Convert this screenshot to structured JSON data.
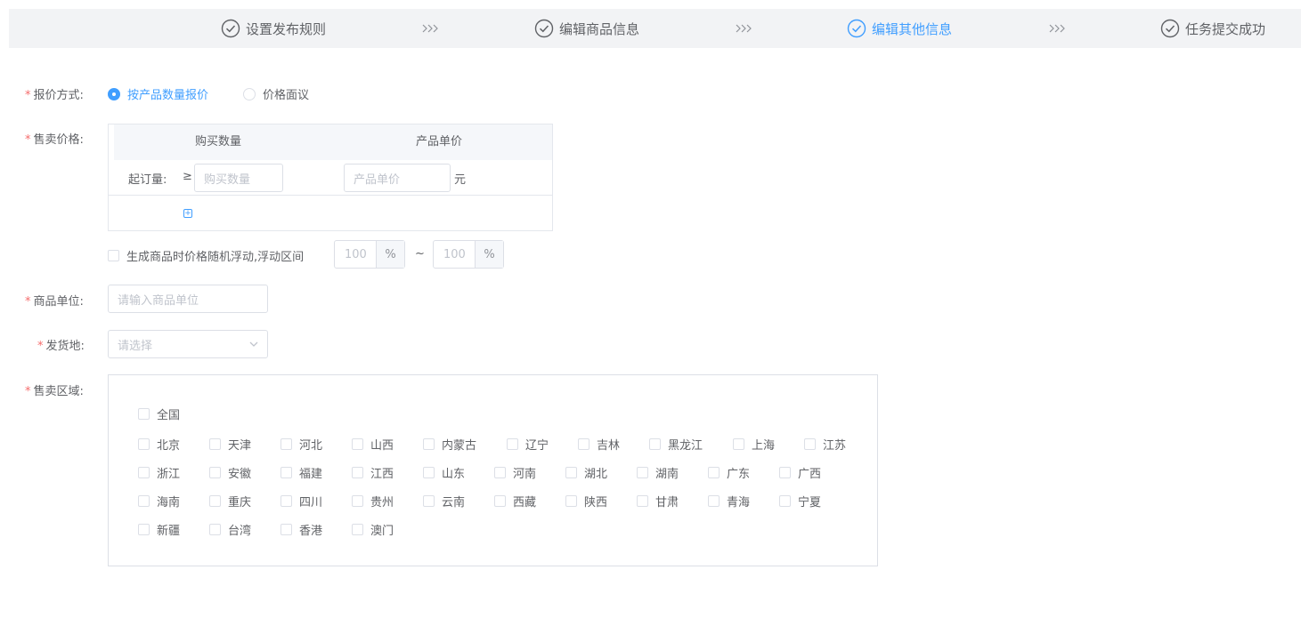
{
  "steps": [
    {
      "label": "设置发布规则",
      "active": false
    },
    {
      "label": "编辑商品信息",
      "active": false
    },
    {
      "label": "编辑其他信息",
      "active": true
    },
    {
      "label": "任务提交成功",
      "active": false
    }
  ],
  "colors": {
    "accent": "#409eff",
    "required": "#f56c6c",
    "border": "#dcdfe6"
  },
  "form": {
    "required_mark": "*",
    "quote_method": {
      "label": "报价方式:",
      "options": [
        "按产品数量报价",
        "价格面议"
      ],
      "selected": "按产品数量报价"
    },
    "sale_price": {
      "label": "售卖价格:",
      "col_qty": "购买数量",
      "col_price": "产品单价",
      "min_order_label": "起订量:",
      "gte": "≥",
      "qty_placeholder": "购买数量",
      "price_placeholder": "产品单价",
      "unit": "元",
      "add_icon": "plus-square-icon"
    },
    "random_float": {
      "label": "生成商品时价格随机浮动,浮动区间",
      "min": "100",
      "max": "100",
      "percent": "%",
      "tilde": "~"
    },
    "product_unit": {
      "label": "商品单位:",
      "placeholder": "请输入商品单位"
    },
    "ship_from": {
      "label": "发货地:",
      "placeholder": "请选择"
    },
    "sale_region": {
      "label": "售卖区域:",
      "all_label": "全国",
      "rows": [
        [
          "北京",
          "天津",
          "河北",
          "山西",
          "内蒙古",
          "辽宁",
          "吉林",
          "黑龙江",
          "上海",
          "江苏"
        ],
        [
          "浙江",
          "安徽",
          "福建",
          "江西",
          "山东",
          "河南",
          "湖北",
          "湖南",
          "广东",
          "广西"
        ],
        [
          "海南",
          "重庆",
          "四川",
          "贵州",
          "云南",
          "西藏",
          "陕西",
          "甘肃",
          "青海",
          "宁夏"
        ],
        [
          "新疆",
          "台湾",
          "香港",
          "澳门"
        ]
      ]
    }
  }
}
